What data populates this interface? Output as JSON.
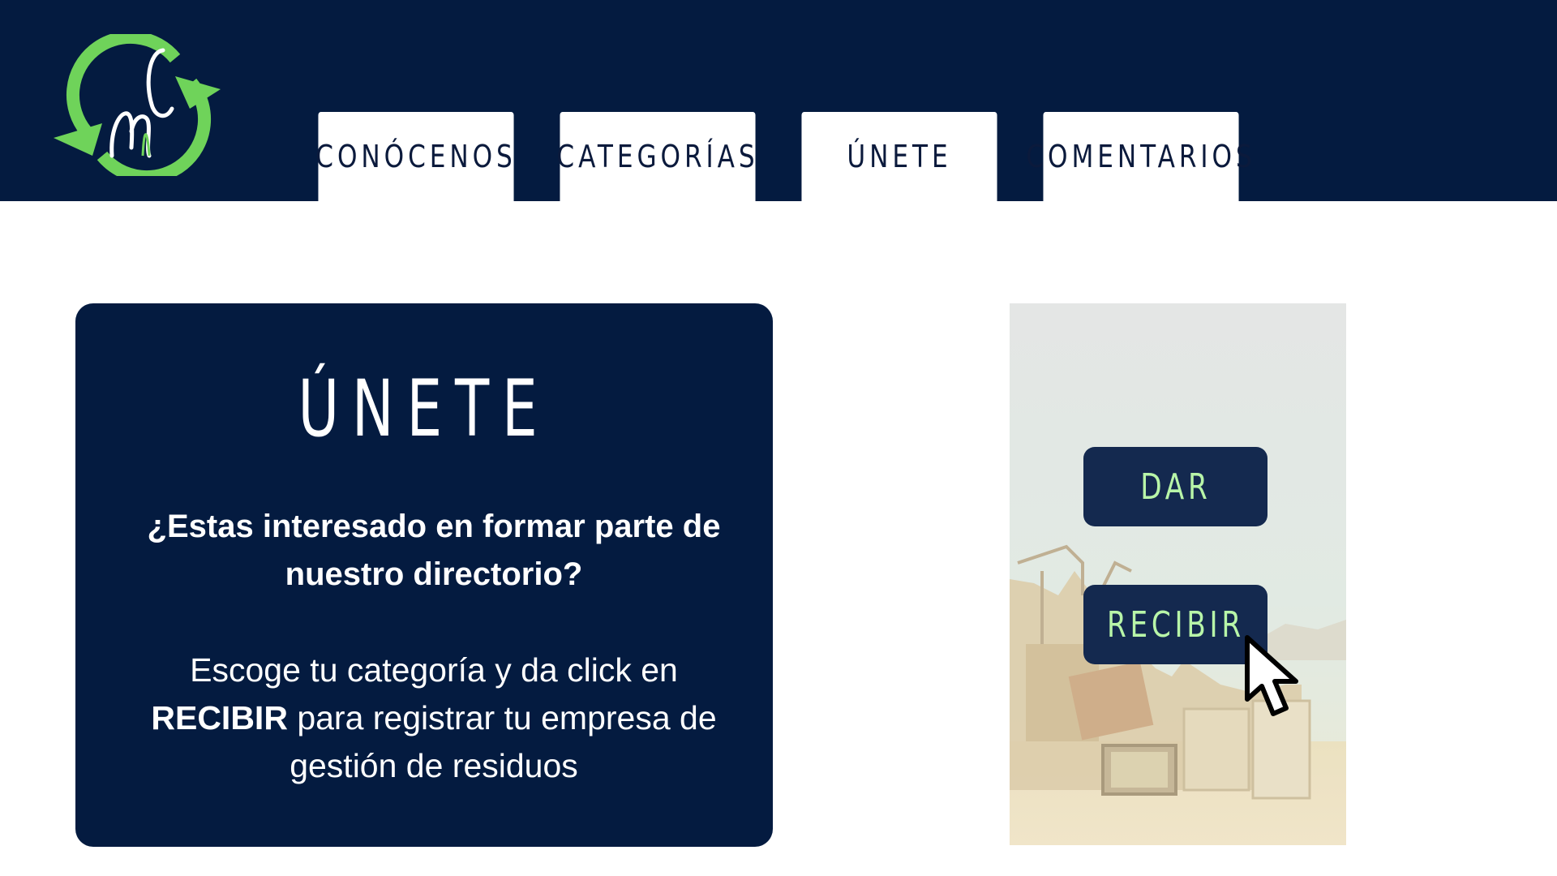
{
  "nav": {
    "tabs": [
      {
        "label": "CONÓCENOS"
      },
      {
        "label": "CATEGORÍAS"
      },
      {
        "label": "ÚNETE"
      },
      {
        "label": "COMENTARIOS"
      }
    ]
  },
  "logo": {
    "icon": "recycle-arrows-nc-logo"
  },
  "join_card": {
    "title": "ÚNETE",
    "question": "¿Estas interesado en formar parte de nuestro directorio?",
    "desc_line1": "Escoge tu categoría y da click en",
    "desc_bold": "RECIBIR",
    "desc_rest": " para registrar tu empresa de",
    "desc_line3": "gestión de residuos"
  },
  "actions": {
    "give_label": "DAR",
    "receive_label": "RECIBIR"
  },
  "colors": {
    "navy": "#041b40",
    "button_bg": "#14294f",
    "accent_green": "#b8f5a8",
    "logo_green": "#6fd35a"
  }
}
